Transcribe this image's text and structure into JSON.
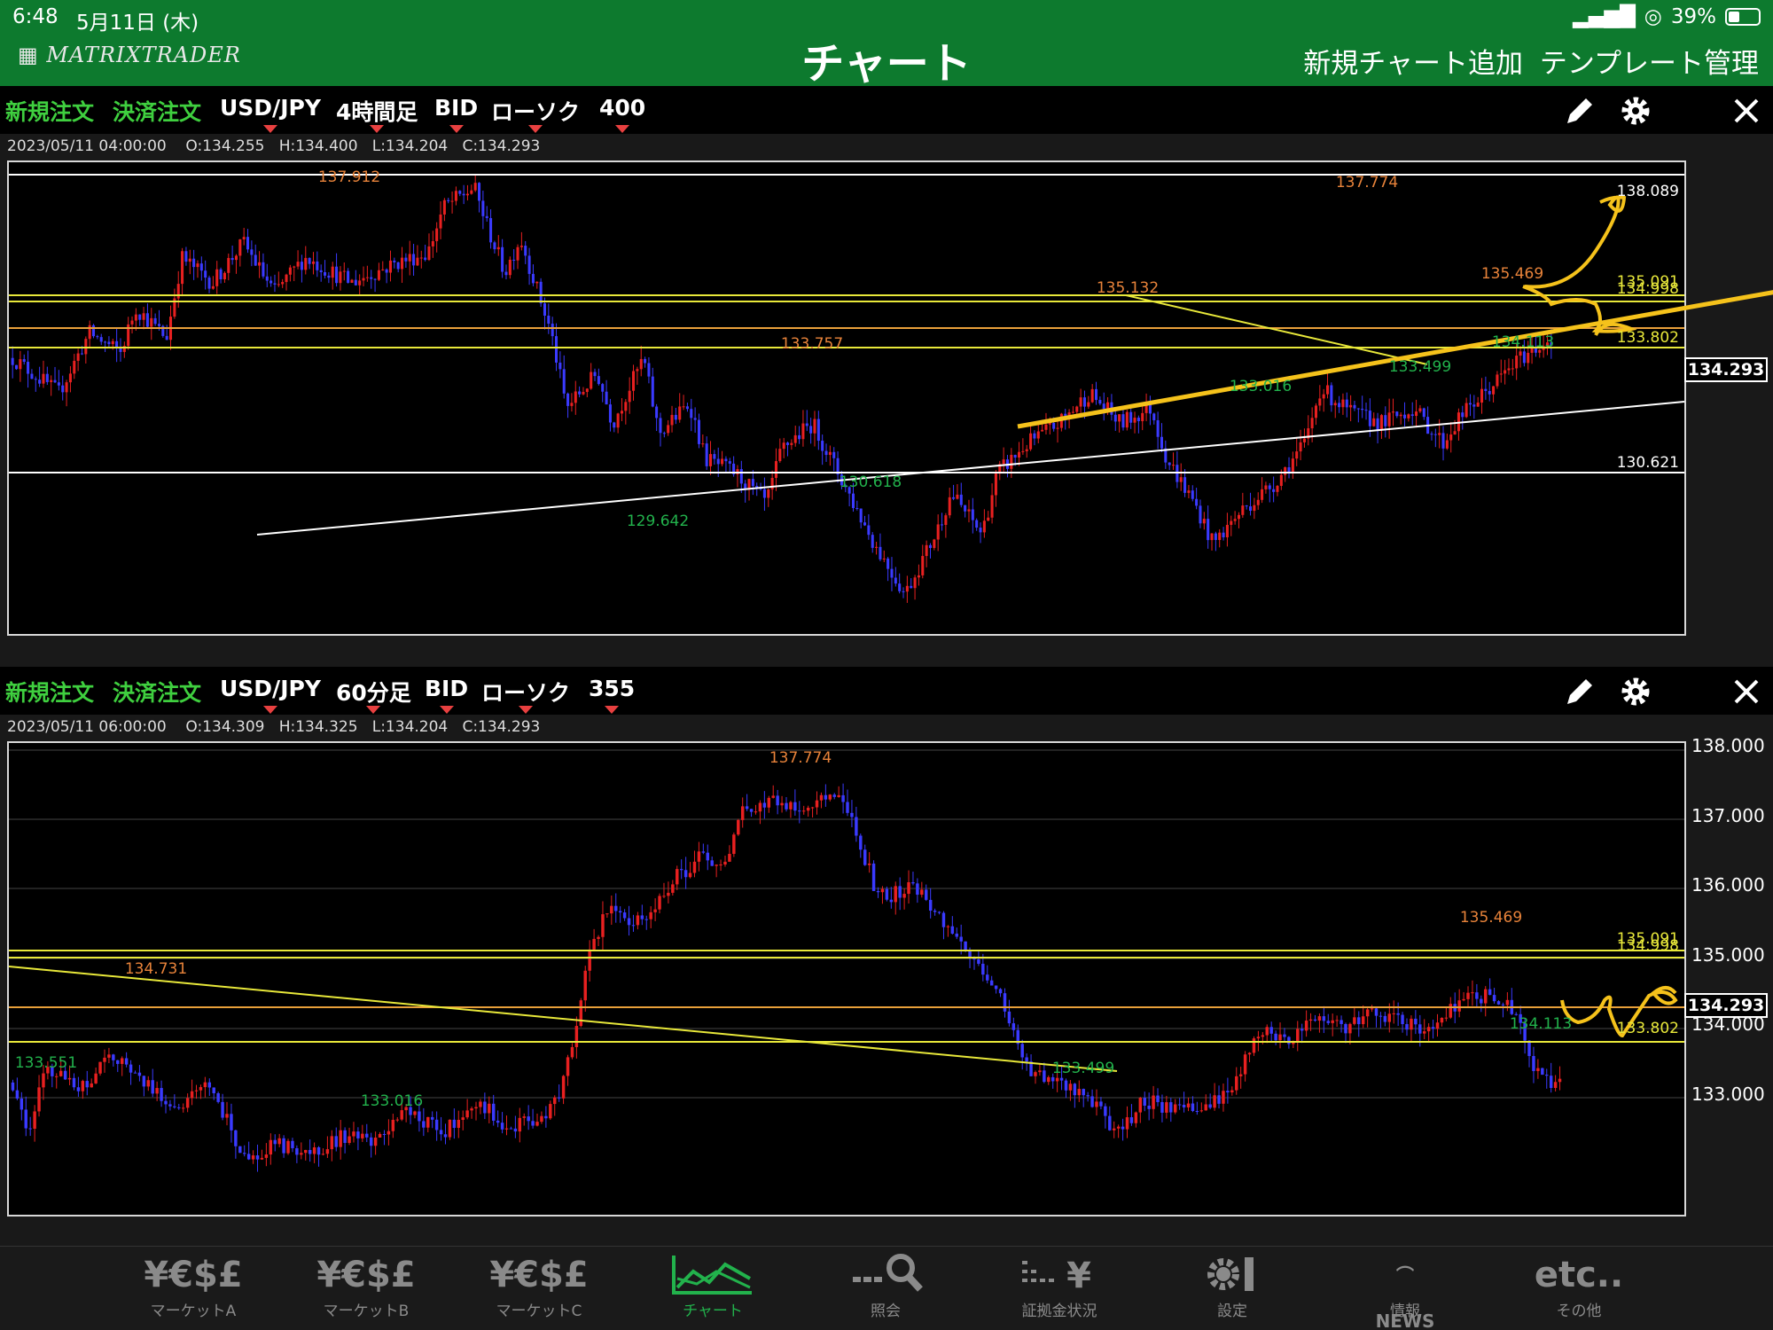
{
  "status": {
    "time": "6:48",
    "date": "5月11日 (木)",
    "battery": "39%"
  },
  "header": {
    "logo": "MATRIXTRADER",
    "title": "チャート",
    "add_chart": "新規チャート追加",
    "template": "テンプレート管理"
  },
  "panels": [
    {
      "new_order": "新規注文",
      "close_order": "決済注文",
      "pair": "USD/JPY",
      "timeframe": "4時間足",
      "price_type": "BID",
      "chart_style": "ローソク",
      "bars": "400",
      "ohlc": {
        "date": "2023/05/11 04:00:00",
        "open": "O:134.255",
        "high": "H:134.400",
        "low": "L:134.204",
        "close": "C:134.293"
      },
      "current_price": "134.293",
      "axis_labels": [
        "138.089",
        "134.998",
        "135.091",
        "133.802",
        "130.621"
      ],
      "annotations": {
        "high_a": "137.912",
        "high_b": "137.774",
        "mid_a": "135.132",
        "mid_b": "133.757",
        "mid_c": "135.469",
        "low_a": "129.642",
        "low_b": "130.618",
        "low_c": "133.016",
        "low_d": "133.499",
        "low_e": "134.113"
      }
    },
    {
      "new_order": "新規注文",
      "close_order": "決済注文",
      "pair": "USD/JPY",
      "timeframe": "60分足",
      "price_type": "BID",
      "chart_style": "ローソク",
      "bars": "355",
      "ohlc": {
        "date": "2023/05/11 06:00:00",
        "open": "O:134.309",
        "high": "H:134.325",
        "low": "L:134.204",
        "close": "C:134.293"
      },
      "current_price": "134.293",
      "axis_labels": [
        "138.000",
        "137.000",
        "136.000",
        "135.000",
        "134.000",
        "133.000",
        "135.091",
        "134.998",
        "133.802"
      ],
      "annotations": {
        "high_a": "137.774",
        "mid_a": "134.731",
        "mid_b": "135.469",
        "low_a": "133.551",
        "low_b": "133.016",
        "low_c": "133.499",
        "low_d": "134.113"
      }
    }
  ],
  "chart_data": [
    {
      "type": "candlestick",
      "title": "USD/JPY 4時間足",
      "ylim": [
        129.0,
        138.4
      ],
      "current": 134.293,
      "series_path": [
        [
          0,
          134.5
        ],
        [
          0.03,
          133.8
        ],
        [
          0.05,
          135.0
        ],
        [
          0.07,
          134.6
        ],
        [
          0.08,
          135.5
        ],
        [
          0.1,
          134.9
        ],
        [
          0.11,
          136.5
        ],
        [
          0.13,
          136.0
        ],
        [
          0.15,
          136.8
        ],
        [
          0.17,
          135.8
        ],
        [
          0.19,
          136.5
        ],
        [
          0.22,
          136.0
        ],
        [
          0.25,
          136.4
        ],
        [
          0.27,
          136.6
        ],
        [
          0.28,
          137.5
        ],
        [
          0.3,
          137.9
        ],
        [
          0.31,
          137.0
        ],
        [
          0.32,
          136.2
        ],
        [
          0.33,
          136.9
        ],
        [
          0.35,
          135.0
        ],
        [
          0.36,
          133.5
        ],
        [
          0.38,
          134.2
        ],
        [
          0.39,
          133.2
        ],
        [
          0.41,
          134.5
        ],
        [
          0.42,
          133.0
        ],
        [
          0.44,
          133.6
        ],
        [
          0.45,
          132.5
        ],
        [
          0.47,
          132.2
        ],
        [
          0.49,
          131.6
        ],
        [
          0.5,
          132.7
        ],
        [
          0.52,
          133.2
        ],
        [
          0.54,
          132.0
        ],
        [
          0.56,
          130.8
        ],
        [
          0.58,
          129.8
        ],
        [
          0.6,
          131.0
        ],
        [
          0.61,
          131.8
        ],
        [
          0.63,
          131.0
        ],
        [
          0.64,
          132.2
        ],
        [
          0.66,
          132.8
        ],
        [
          0.68,
          133.2
        ],
        [
          0.7,
          133.8
        ],
        [
          0.72,
          133.2
        ],
        [
          0.74,
          133.5
        ],
        [
          0.75,
          132.5
        ],
        [
          0.77,
          131.5
        ],
        [
          0.78,
          130.8
        ],
        [
          0.8,
          131.5
        ],
        [
          0.82,
          132.0
        ],
        [
          0.84,
          132.8
        ],
        [
          0.85,
          133.9
        ],
        [
          0.87,
          133.4
        ],
        [
          0.89,
          133.2
        ],
        [
          0.91,
          133.5
        ],
        [
          0.93,
          132.8
        ],
        [
          0.94,
          133.3
        ],
        [
          0.96,
          133.9
        ],
        [
          0.98,
          134.5
        ],
        [
          1.0,
          134.9
        ]
      ],
      "annotations": [
        "137.912",
        "137.774",
        "135.132",
        "133.757",
        "135.469",
        "129.642",
        "130.618",
        "133.016",
        "133.499",
        "134.113"
      ]
    },
    {
      "type": "candlestick",
      "title": "USD/JPY 60分足",
      "ylim": [
        132.8,
        138.15
      ],
      "current": 134.293,
      "annotations": [
        "137.774",
        "134.731",
        "135.469",
        "133.551",
        "133.016",
        "133.499",
        "134.113"
      ]
    }
  ],
  "tabs": [
    {
      "icon": "¥€$£",
      "label": "マーケットA",
      "name": "tab-market-a"
    },
    {
      "icon": "¥€$£",
      "label": "マーケットB",
      "name": "tab-market-b"
    },
    {
      "icon": "¥€$£",
      "label": "マーケットC",
      "name": "tab-market-c"
    },
    {
      "icon": "chart",
      "label": "チャート",
      "name": "tab-chart",
      "active": true
    },
    {
      "icon": "search",
      "label": "照会",
      "name": "tab-inquiry"
    },
    {
      "icon": "margin",
      "label": "証拠金状況",
      "name": "tab-margin"
    },
    {
      "icon": "gear",
      "label": "設定",
      "name": "tab-settings"
    },
    {
      "icon": "NEWS",
      "label": "情報",
      "name": "tab-news"
    },
    {
      "icon": "etc..",
      "label": "その他",
      "name": "tab-other"
    }
  ],
  "colors": {
    "header_green": "#0d7a2e",
    "bull": "#e82020",
    "bear": "#3a3aff",
    "hline_yellow": "#e8e83a",
    "trend_orange": "#f5c21b",
    "label_orange": "#e8833a",
    "label_green": "#22b24c"
  }
}
